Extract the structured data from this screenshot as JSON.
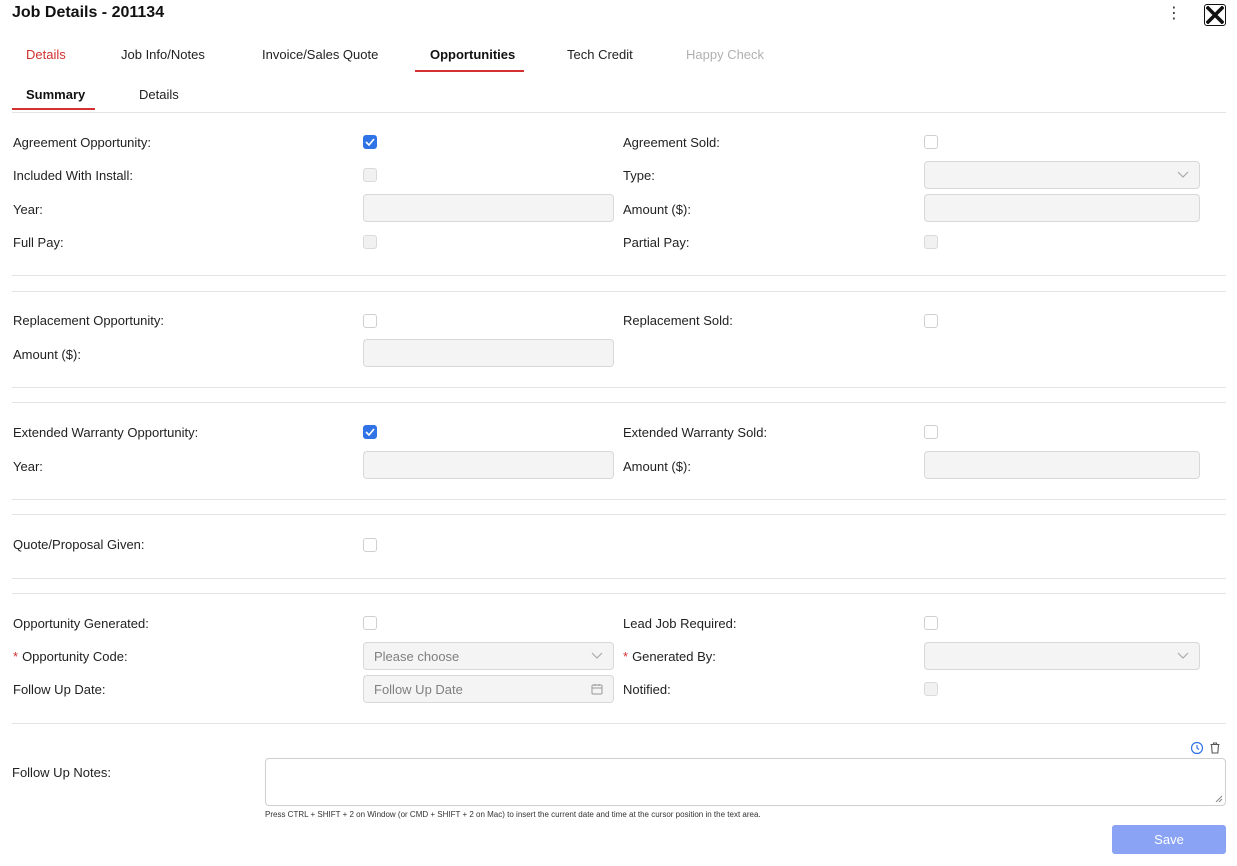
{
  "header": {
    "title": "Job Details - 201134"
  },
  "tabs": [
    "Details",
    "Job Info/Notes",
    "Invoice/Sales Quote",
    "Opportunities",
    "Tech Credit",
    "Happy Check"
  ],
  "subtabs": [
    "Summary",
    "Details"
  ],
  "agreement": {
    "opportunity_label": "Agreement Opportunity",
    "sold_label": "Agreement Sold",
    "included_label": "Included With Install",
    "type_label": "Type",
    "year_label": "Year",
    "amount_label": "Amount ($)",
    "full_pay_label": "Full Pay",
    "partial_pay_label": "Partial Pay"
  },
  "replacement": {
    "opportunity_label": "Replacement Opportunity",
    "sold_label": "Replacement Sold",
    "amount_label": "Amount ($)"
  },
  "warranty": {
    "opportunity_label": "Extended Warranty Opportunity",
    "sold_label": "Extended Warranty Sold",
    "year_label": "Year",
    "amount_label": "Amount ($)"
  },
  "quote": {
    "label": "Quote/Proposal Given"
  },
  "generated": {
    "opportunity_label": "Opportunity Generated",
    "lead_label": "Lead Job Required",
    "code_label": "Opportunity Code",
    "code_placeholder": "Please choose",
    "generated_by_label": "Generated By",
    "follow_up_label": "Follow Up Date",
    "follow_up_placeholder": "Follow Up Date",
    "notified_label": "Notified"
  },
  "notes": {
    "label": "Follow Up Notes",
    "hint": "Press CTRL + SHIFT + 2 on Window (or CMD + SHIFT + 2 on Mac) to insert the current date and time at the cursor position in the text area."
  },
  "save_label": "Save"
}
